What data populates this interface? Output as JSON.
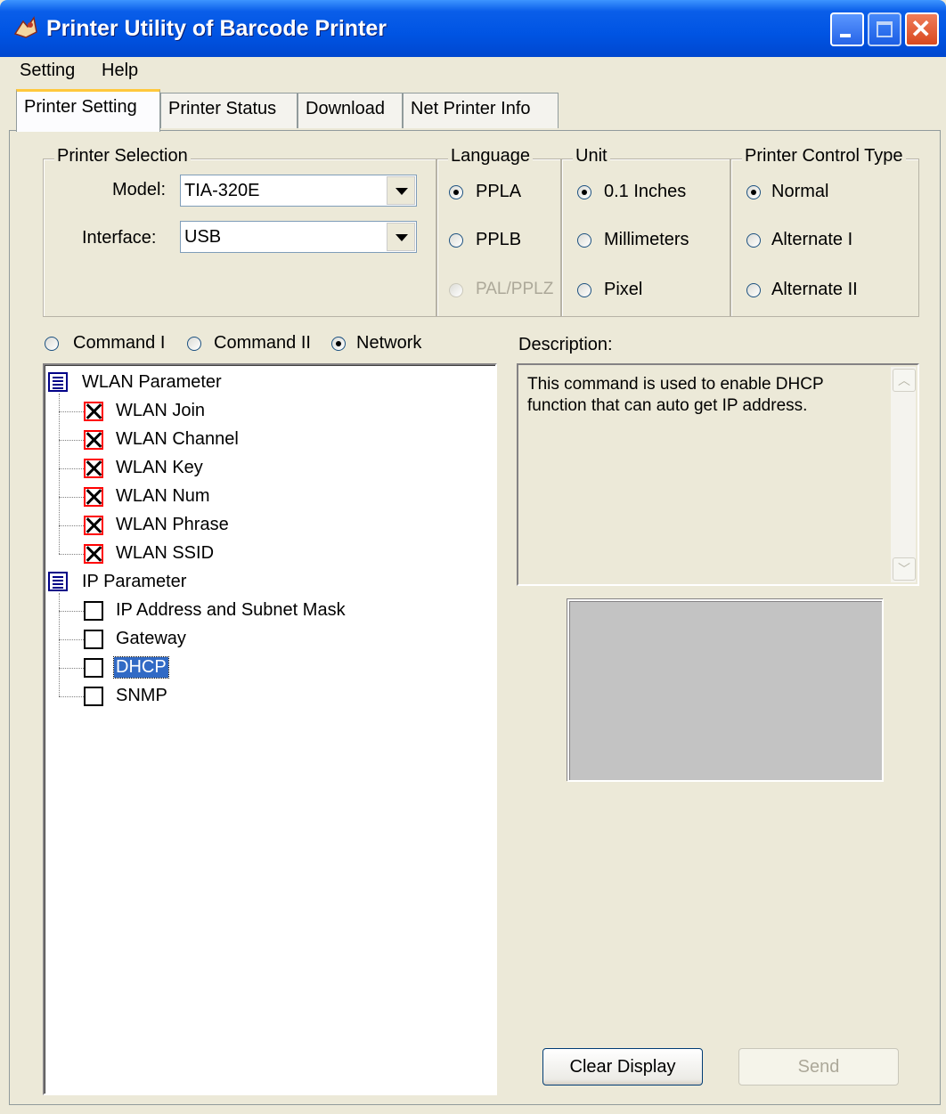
{
  "window": {
    "title": "Printer Utility of Barcode Printer"
  },
  "menu": [
    "Setting",
    "Help"
  ],
  "tabs": [
    "Printer Setting",
    "Printer Status",
    "Download",
    "Net Printer Info"
  ],
  "printer_selection": {
    "legend": "Printer Selection",
    "model_label": "Model:",
    "model_value": "TIA-320E",
    "interface_label": "Interface:",
    "interface_value": "USB"
  },
  "language": {
    "legend": "Language",
    "options": [
      "PPLA",
      "PPLB",
      "PAL/PPLZ"
    ],
    "selected": "PPLA"
  },
  "unit": {
    "legend": "Unit",
    "options": [
      "0.1 Inches",
      "Millimeters",
      "Pixel"
    ],
    "selected": "0.1 Inches"
  },
  "control_type": {
    "legend": "Printer Control Type",
    "options": [
      "Normal",
      "Alternate I",
      "Alternate II"
    ],
    "selected": "Normal"
  },
  "command_mode": {
    "options": [
      "Command I",
      "Command II",
      "Network"
    ],
    "selected": "Network"
  },
  "tree": {
    "groups": [
      {
        "label": "WLAN Parameter",
        "items": [
          "WLAN Join",
          "WLAN Channel",
          "WLAN Key",
          "WLAN Num",
          "WLAN Phrase",
          "WLAN SSID"
        ]
      },
      {
        "label": "IP Parameter",
        "items": [
          "IP Address and Subnet Mask",
          "Gateway",
          "DHCP",
          "SNMP"
        ]
      }
    ],
    "selected_item": "DHCP"
  },
  "description": {
    "label": "Description:",
    "text": "This command is used to enable DHCP function that can auto get IP address."
  },
  "buttons": {
    "clear": "Clear Display",
    "send": "Send"
  }
}
